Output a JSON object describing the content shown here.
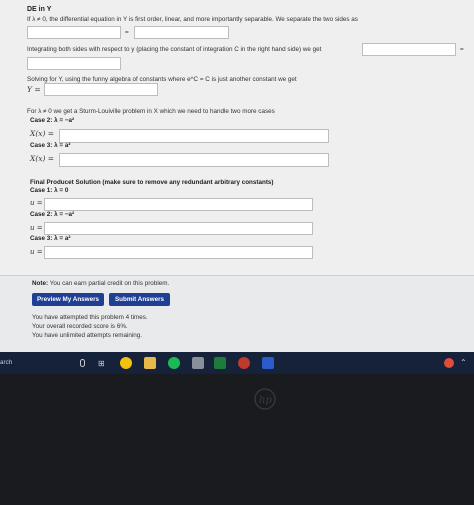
{
  "problem": {
    "heading": "DE in Y",
    "line1_prefix": "If λ ≠ 0, the differential equation in Y is first order, linear, and more importantly separable. We separate the two sides as",
    "equals": "=",
    "integrate_text": "Integrating both sides with respect to y (placing the constant of integration C in the right hand side) we get",
    "solve_text": "Solving for Y, using the funny algebra of constants where e^C = C is just another constant we get",
    "y_label": "Y =",
    "sturm_text": "For λ ≠ 0 we get a Sturm-Louiville problem in X which we need to handle two more cases",
    "case2_label": "Case 2: λ = −a²",
    "x_label": "X(x) =",
    "case3_label": "Case 3: λ = a²",
    "final_heading": "Final Producet Solution (make sure to remove any redundant arbitrary constants)",
    "final_case1": "Case 1: λ = 0",
    "final_case2": "Case 2: λ = −a²",
    "final_case3": "Case 3: λ = a²",
    "u_label": "u ="
  },
  "note": {
    "label": "Note:",
    "text": "You can earn partial credit on this problem."
  },
  "buttons": {
    "preview": "Preview My Answers",
    "submit": "Submit Answers"
  },
  "status": {
    "attempts": "You have attempted this problem 4 times.",
    "score": "Your overall recorded score is 6%.",
    "remaining": "You have unlimited attempts remaining."
  },
  "taskbar": {
    "search_fragment": "arch"
  },
  "colors": {
    "button": "#1f3f94",
    "taskbar": "#16213a"
  }
}
